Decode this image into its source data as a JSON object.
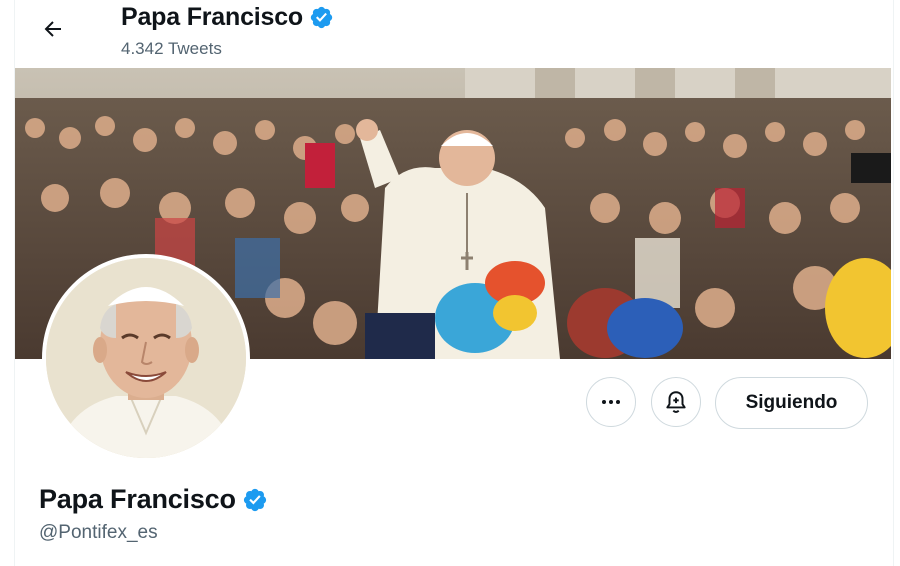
{
  "header": {
    "display_name": "Papa Francisco",
    "tweet_count": "4.342 Tweets"
  },
  "profile": {
    "display_name": "Papa Francisco",
    "handle": "@Pontifex_es",
    "verified": true
  },
  "actions": {
    "more_icon": "more-horizontal-icon",
    "notify_icon": "bell-plus-icon",
    "following_label": "Siguiendo"
  },
  "icons": {
    "back": "arrow-left-icon",
    "verified": "verified-badge-icon"
  },
  "colors": {
    "verified_blue": "#1d9bf0",
    "secondary_text": "#536471",
    "border": "#cfd9de"
  }
}
